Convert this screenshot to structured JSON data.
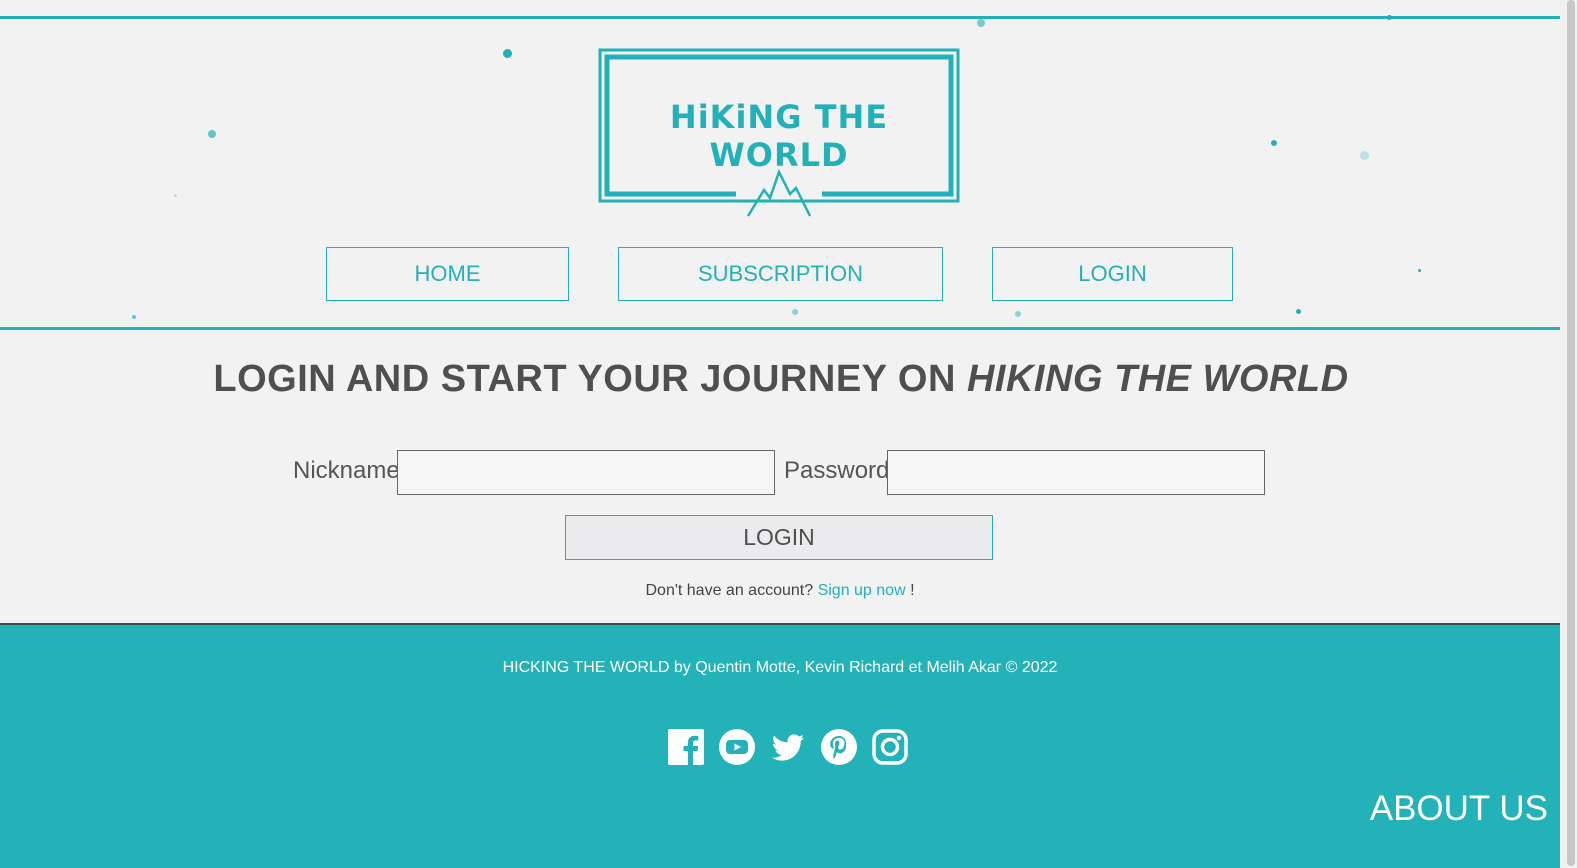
{
  "colors": {
    "accent": "#23b1b9",
    "footer_bg": "#24b2b9",
    "text": "#555555"
  },
  "header": {
    "logo_text": "HiKiNG THE WORLD",
    "nav": [
      {
        "label": "HOME"
      },
      {
        "label": "SUBSCRIPTION"
      },
      {
        "label": "LOGIN"
      }
    ]
  },
  "main": {
    "title_plain": "LOGIN AND START YOUR JOURNEY ON ",
    "title_emphasis": "HIKING THE WORLD",
    "nickname_label": "Nickname",
    "nickname_value": "",
    "password_label": "Password",
    "password_value": "",
    "submit_label": "LOGIN",
    "signup_prefix": "Don't have an account?",
    "signup_link": "Sign up now",
    "signup_suffix": " !"
  },
  "footer": {
    "credits": "HICKING THE WORLD by Quentin Motte, Kevin Richard et Melih Akar © 2022",
    "socials": [
      "facebook-icon",
      "youtube-icon",
      "twitter-icon",
      "pinterest-icon",
      "instagram-icon"
    ],
    "about_label": "ABOUT US"
  }
}
